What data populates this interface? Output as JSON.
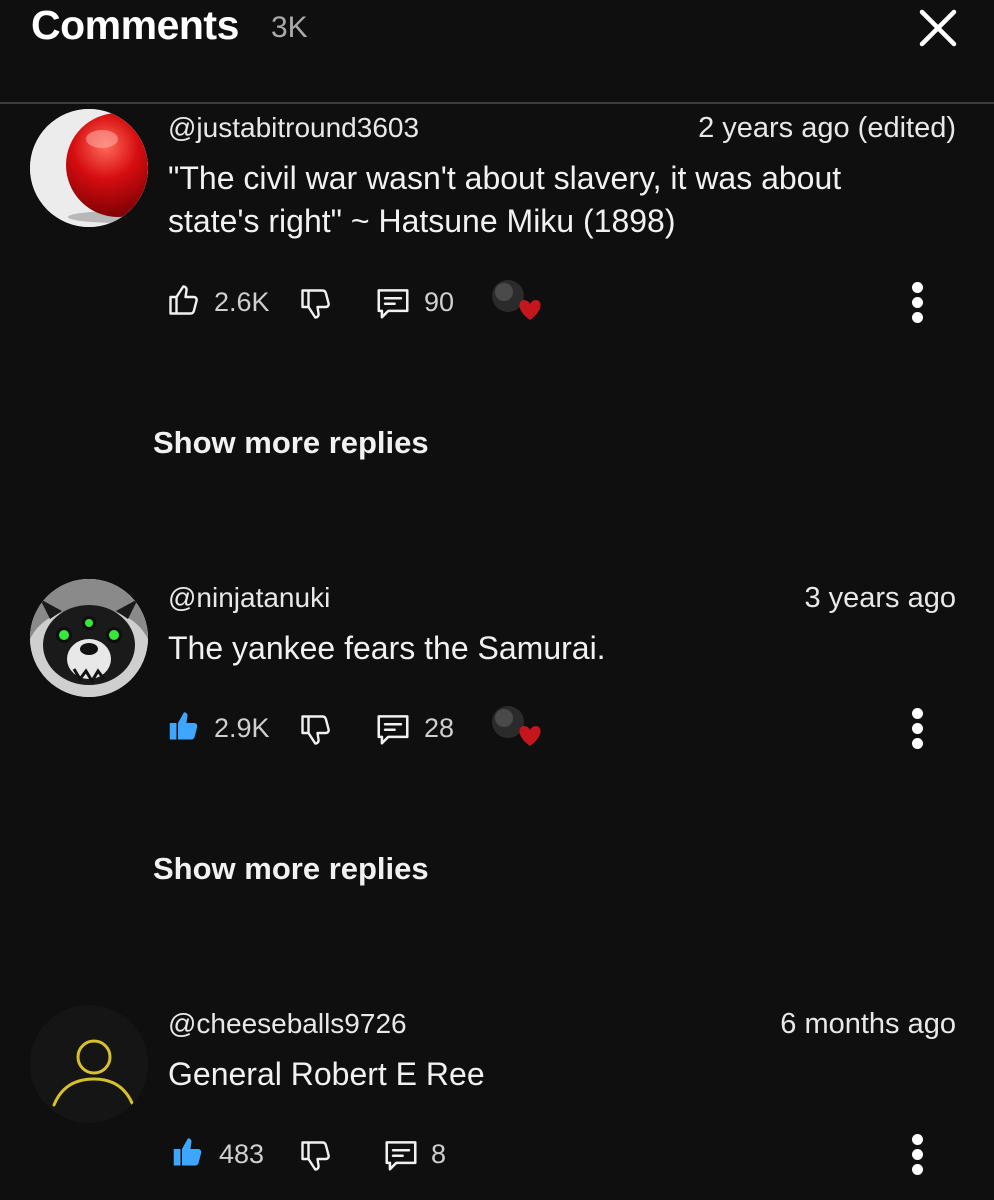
{
  "header": {
    "title": "Comments",
    "count": "3K"
  },
  "comments": [
    {
      "author": "@justabitround3603",
      "time": "2 years ago (edited)",
      "text": "\"The civil war wasn't about slavery, it was about state's right\" ~ Hatsune Miku (1898)",
      "likes": "2.6K",
      "liked": false,
      "replies": "90",
      "creator_hearted": true,
      "show_more_label": "Show more replies"
    },
    {
      "author": "@ninjatanuki",
      "time": "3 years ago",
      "text": "The yankee fears the Samurai.",
      "likes": "2.9K",
      "liked": true,
      "replies": "28",
      "creator_hearted": true,
      "show_more_label": "Show more replies"
    },
    {
      "author": "@cheeseballs9726",
      "time": "6 months ago",
      "text": "General Robert E Ree",
      "likes": "483",
      "liked": true,
      "replies": "8",
      "creator_hearted": false
    }
  ],
  "colors": {
    "background": "#0f0f0f",
    "like_active": "#3ea6ff",
    "heart": "#c4161c"
  }
}
